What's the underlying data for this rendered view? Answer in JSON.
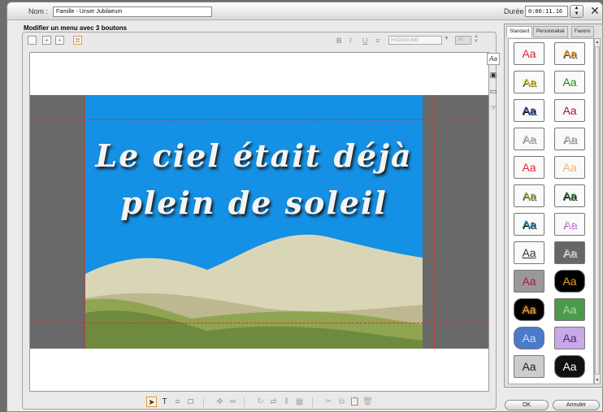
{
  "header": {
    "name_label": "Nom :",
    "name_value": "Famille - Unser Jubilaeum",
    "duration_label": "Durée :",
    "duration_value": "0:00:11.16",
    "close_glyph": "✕"
  },
  "editor": {
    "title": "Modifier un menu avec 3 boutons",
    "format_bold": "B",
    "format_italic": "I",
    "format_underline": "U",
    "format_align": "≡",
    "font_value": "HADAGUND",
    "size_value": "36"
  },
  "canvas": {
    "line1": "Le ciel était déjà",
    "line2": "plein de soleil",
    "colors": {
      "sky": "#1490e4",
      "hill_far": "#d9d6b8",
      "hill_mid": "#bdb88f",
      "grass_light": "#8fa552",
      "grass_dark": "#6f8a3e",
      "border": "#696969",
      "guide": "#e02a2a"
    }
  },
  "bottom_tools": [
    {
      "name": "select-tool-icon",
      "glyph": "➤"
    },
    {
      "name": "text-tool-icon",
      "glyph": "T"
    },
    {
      "name": "ellipse-tool-icon",
      "glyph": "○"
    },
    {
      "name": "rectangle-tool-icon",
      "glyph": "□"
    },
    {
      "name": "move-icon",
      "glyph": "✥"
    },
    {
      "name": "distribute-icon",
      "glyph": "⇹"
    },
    {
      "name": "rotate-icon",
      "glyph": "↻"
    },
    {
      "name": "flip-icon",
      "glyph": "⇄"
    },
    {
      "name": "align-icon",
      "glyph": "⫴"
    },
    {
      "name": "grid-icon",
      "glyph": "▦"
    },
    {
      "name": "cut-icon",
      "glyph": "✂"
    },
    {
      "name": "copy-icon",
      "glyph": "⧉"
    },
    {
      "name": "paste-icon",
      "glyph": "📋"
    },
    {
      "name": "delete-icon",
      "glyph": "🗑"
    }
  ],
  "side_tools": [
    {
      "name": "text-style-icon",
      "glyph": "Aa"
    },
    {
      "name": "image-icon",
      "glyph": "▣"
    },
    {
      "name": "frame-icon",
      "glyph": "▭"
    },
    {
      "name": "button-link-icon",
      "glyph": "☞"
    }
  ],
  "styles_panel": {
    "tabs": [
      "Standard",
      "Personnalisé",
      "Favoris"
    ],
    "sample": "Aa"
  },
  "buttons": {
    "ok": "OK",
    "cancel": "Annuler"
  }
}
